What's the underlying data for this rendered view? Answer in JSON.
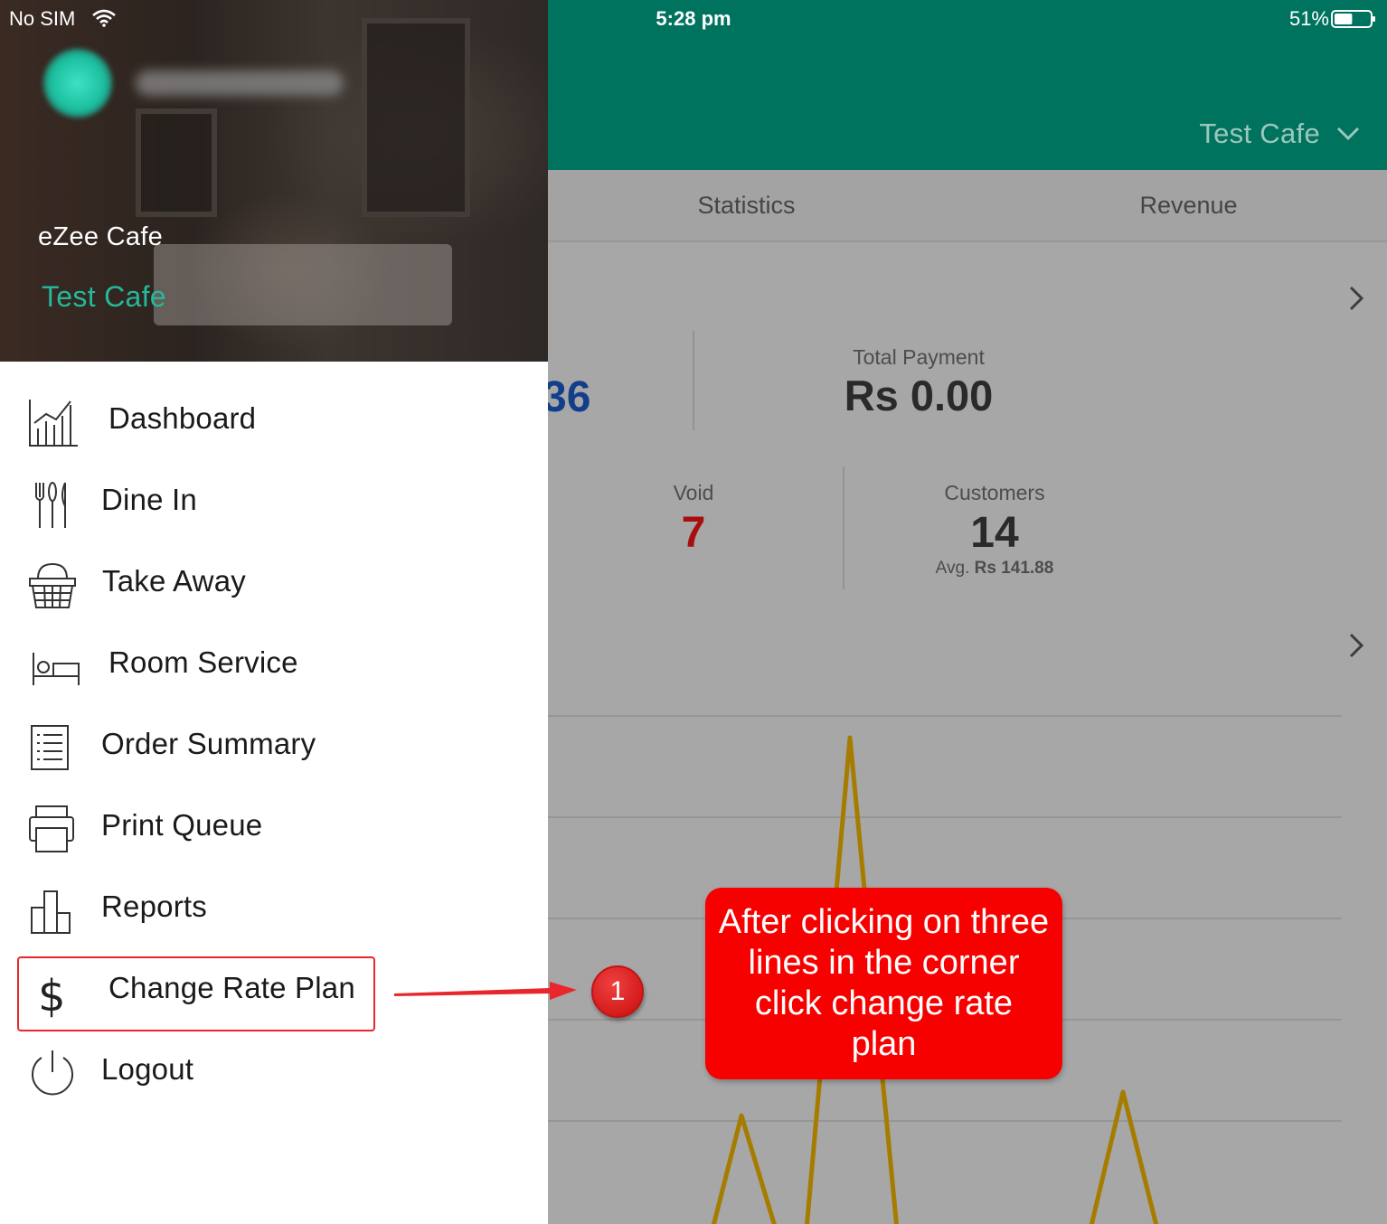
{
  "status_bar": {
    "carrier": "No SIM",
    "time": "5:28 pm",
    "battery": "51%",
    "battery_level": 0.51,
    "wifi_icon": "wifi-icon"
  },
  "header": {
    "outlet_selector": "Test Cafe",
    "icon": "chevron-down-icon",
    "background": "#00735f"
  },
  "tabs": [
    {
      "label": "Statistics"
    },
    {
      "label": "Revenue"
    }
  ],
  "stats": {
    "sales_partial": "36",
    "total_payment": {
      "label": "Total Payment",
      "value": "Rs 0.00"
    },
    "void": {
      "label": "Void",
      "value": "7"
    },
    "customers": {
      "label": "Customers",
      "value": "14",
      "avg_label": "Avg.",
      "avg_value": "Rs 141.88"
    }
  },
  "drawer": {
    "company": "eZee Cafe",
    "outlet": "Test Cafe",
    "accent": "#26b89a",
    "menu": [
      {
        "label": "Dashboard",
        "icon": "dashboard-icon"
      },
      {
        "label": "Dine In",
        "icon": "cutlery-icon"
      },
      {
        "label": "Take Away",
        "icon": "basket-icon"
      },
      {
        "label": "Room Service",
        "icon": "bed-icon"
      },
      {
        "label": "Order Summary",
        "icon": "list-icon"
      },
      {
        "label": "Print Queue",
        "icon": "printer-icon"
      },
      {
        "label": "Reports",
        "icon": "bar-chart-icon"
      },
      {
        "label": "Change Rate Plan",
        "icon": "dollar-icon"
      },
      {
        "label": "Logout",
        "icon": "power-icon"
      }
    ]
  },
  "annotation": {
    "step": "1",
    "callout": "After clicking on three lines in the corner click change rate plan",
    "color": "#f70000"
  }
}
